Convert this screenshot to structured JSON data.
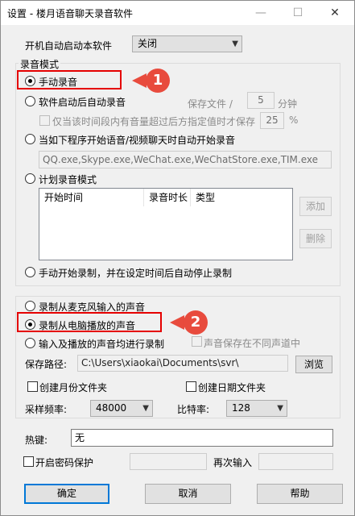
{
  "window": {
    "title": "设置 - 楼月语音聊天录音软件",
    "minimize": "—",
    "maximize": "☐",
    "close": "✕"
  },
  "autostart": {
    "label": "开机自动启动本软件",
    "value": "关闭"
  },
  "record_mode": {
    "group_label": "录音模式",
    "manual": "手动录音",
    "auto_on_start": "软件启动后自动录音",
    "save_file_label": "保存文件 /",
    "save_file_minutes": "5",
    "minutes_unit": "分钟",
    "only_save_label": "仅当该时间段内有音量超过后方指定值时才保存",
    "only_save_value": "25",
    "percent": "%",
    "auto_on_program": "当如下程序开始语音/视频聊天时自动开始录音",
    "program_list": "QQ.exe,Skype.exe,WeChat.exe,WeChatStore.exe,TIM.exe",
    "scheduled": "计划录音模式",
    "table_headers": [
      "开始时间",
      "录音时长",
      "类型"
    ],
    "add_button": "添加",
    "delete_button": "删除",
    "manual_then_stop": "手动开始录制，并在设定时间后自动停止录制"
  },
  "source": {
    "mic": "录制从麦克风输入的声音",
    "speaker": "录制从电脑播放的声音",
    "both": "输入及播放的声音均进行录制",
    "separate_channels": "声音保存在不同声道中",
    "save_path_label": "保存路径:",
    "save_path": "C:\\Users\\xiaokai\\Documents\\svr\\",
    "browse": "浏览",
    "month_folder": "创建月份文件夹",
    "date_folder": "创建日期文件夹",
    "sample_rate_label": "采样频率:",
    "sample_rate": "48000",
    "bitrate_label": "比特率:",
    "bitrate": "128"
  },
  "hotkey": {
    "label": "热键:",
    "value": "无"
  },
  "password": {
    "label": "开启密码保护",
    "repeat_label": "再次输入"
  },
  "buttons": {
    "ok": "确定",
    "cancel": "取消",
    "help": "帮助"
  },
  "annotations": {
    "badge1": "1",
    "badge2": "2",
    "color": "#e84b3d",
    "box_color": "#e50000"
  }
}
